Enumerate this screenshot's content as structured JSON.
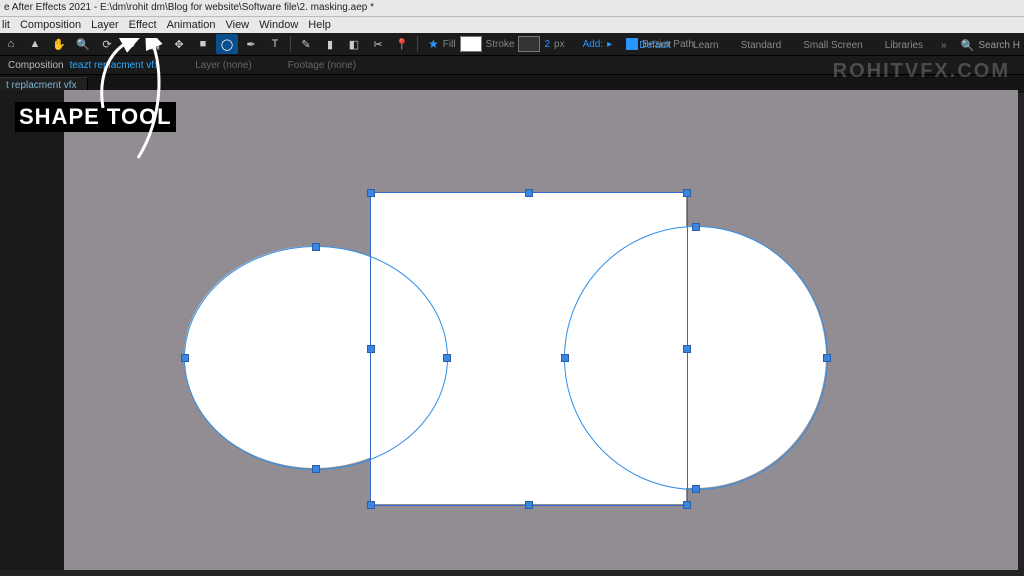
{
  "title": "e After Effects 2021 - E:\\dm\\rohit dm\\Blog for website\\Software file\\2. masking.aep *",
  "menus": [
    "lit",
    "Composition",
    "Layer",
    "Effect",
    "Animation",
    "View",
    "Window",
    "Help"
  ],
  "toolbar": {
    "fill_label": "Fill",
    "stroke_label": "Stroke",
    "stroke_value": "2",
    "stroke_unit": "px",
    "add_label": "Add:",
    "add_icon": "▸",
    "star_icon": "★",
    "bezier_label": "Bezier Path"
  },
  "workspace": {
    "items": [
      "Default",
      "Learn",
      "Standard",
      "Small Screen",
      "Libraries"
    ],
    "active": "Default",
    "overflow": "»",
    "search_placeholder": "Search H"
  },
  "crumbs": {
    "label": "Composition",
    "comp": "teazt replacment vfx",
    "layer_label": "Layer",
    "layer_value": "(none)",
    "footage_label": "Footage",
    "footage_value": "(none)"
  },
  "tab": {
    "name": "t replacment vfx"
  },
  "annotation": {
    "label": "SHAPE TOOL"
  },
  "watermark": "ROHITVFX.COM",
  "icons": {
    "home": "⌂",
    "select": "▲",
    "hand": "✋",
    "zoom": "🔍",
    "orbit": "⟳",
    "rotate": "↻",
    "camera": "▦",
    "pan": "✥",
    "rect": "■",
    "ellipse": "◯",
    "pen": "✒",
    "type": "T",
    "brush": "✎",
    "stamp": "▮",
    "eraser": "◧",
    "roto": "✂",
    "pin": "📍",
    "search": "🔍"
  }
}
